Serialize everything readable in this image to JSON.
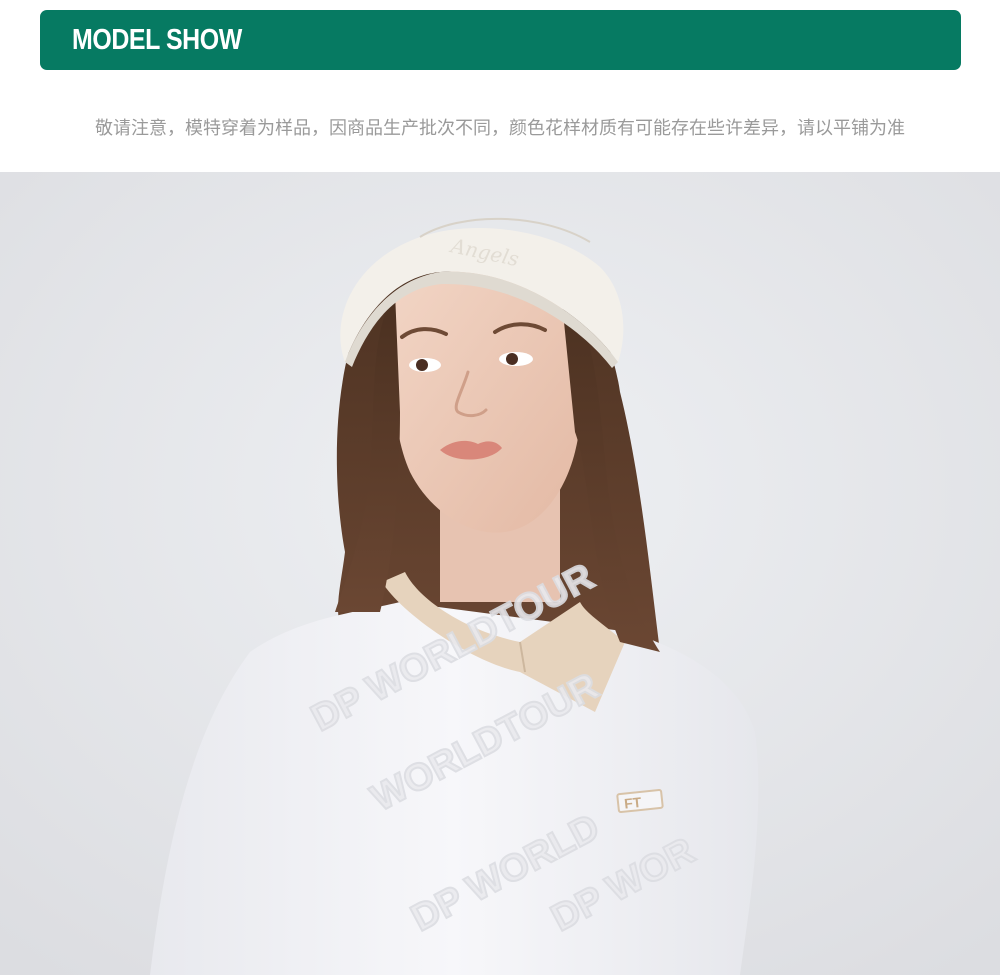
{
  "header": {
    "title": "MODEL SHOW",
    "color": "#067a62"
  },
  "notice": {
    "text": "敬请注意，模特穿着为样品，因商品生产批次不同，颜色花样材质有可能存在些许差异，请以平铺为准"
  },
  "photo": {
    "subject": "model-photo",
    "background_color": "#e4e5e9",
    "shirt_color": "#f4f4f7",
    "collar_color": "#e6d3bd",
    "visor_color": "#f3f0ea",
    "hair_color": "#5a3b2a",
    "embossed_text": "DP WORLD TOUR",
    "badge_text": "FT"
  }
}
